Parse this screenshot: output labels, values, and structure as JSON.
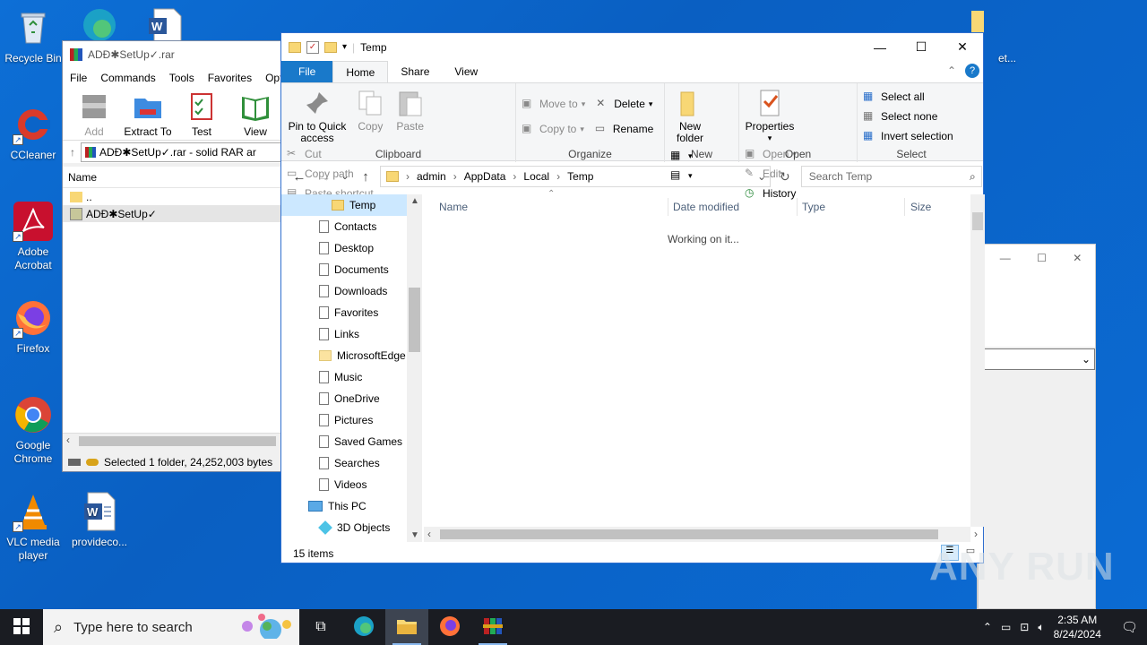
{
  "desktop": {
    "icons": [
      {
        "label": "Recycle Bin",
        "icon": "recycle-bin-icon"
      },
      {
        "label": "CCleaner",
        "icon": "ccleaner-icon"
      },
      {
        "label": "Adobe Acrobat",
        "icon": "acrobat-icon"
      },
      {
        "label": "Firefox",
        "icon": "firefox-icon"
      },
      {
        "label": "Google Chrome",
        "icon": "chrome-icon"
      },
      {
        "label": "VLC media player",
        "icon": "vlc-icon"
      },
      {
        "label": "provideco...",
        "icon": "word-doc-icon"
      },
      {
        "label": "et...",
        "icon": "folder-icon"
      }
    ]
  },
  "winrar": {
    "title": "ADĐ✱SetUp✓.rar",
    "menu": [
      "File",
      "Commands",
      "Tools",
      "Favorites",
      "Optio"
    ],
    "tools": [
      "Add",
      "Extract To",
      "Test",
      "View"
    ],
    "address": "ADĐ✱SetUp✓.rar - solid RAR ar",
    "column_name": "Name",
    "rows": [
      "..",
      "ADĐ✱SetUp✓"
    ],
    "status": "Selected 1 folder, 24,252,003 bytes"
  },
  "explorer": {
    "title": "Temp",
    "tabs": [
      "File",
      "Home",
      "Share",
      "View"
    ],
    "ribbon": {
      "clipboard": {
        "pin": "Pin to Quick access",
        "copy": "Copy",
        "paste": "Paste",
        "cut": "Cut",
        "copy_path": "Copy path",
        "paste_shortcut": "Paste shortcut",
        "label": "Clipboard"
      },
      "organize": {
        "move_to": "Move to",
        "copy_to": "Copy to",
        "delete": "Delete",
        "rename": "Rename",
        "label": "Organize"
      },
      "new": {
        "new_folder": "New folder",
        "label": "New"
      },
      "open": {
        "properties": "Properties",
        "open": "Open",
        "edit": "Edit",
        "history": "History",
        "label": "Open"
      },
      "select": {
        "select_all": "Select all",
        "select_none": "Select none",
        "invert": "Invert selection",
        "label": "Select"
      }
    },
    "breadcrumb": [
      "admin",
      "AppData",
      "Local",
      "Temp"
    ],
    "search_placeholder": "Search Temp",
    "nav_items": [
      "Temp",
      "Contacts",
      "Desktop",
      "Documents",
      "Downloads",
      "Favorites",
      "Links",
      "MicrosoftEdge",
      "Music",
      "OneDrive",
      "Pictures",
      "Saved Games",
      "Searches",
      "Videos",
      "This PC",
      "3D Objects"
    ],
    "columns": [
      "Name",
      "Date modified",
      "Type",
      "Size"
    ],
    "working_text": "Working on it...",
    "status": "15 items"
  },
  "taskbar": {
    "search_placeholder": "Type here to search",
    "time": "2:35 AM",
    "date": "8/24/2024"
  },
  "watermark": "ANY RUN",
  "colors": {
    "accent": "#1979ca",
    "taskbar": "#1a1c22",
    "desktop": "#0b64c8",
    "selection": "#cce8ff"
  }
}
